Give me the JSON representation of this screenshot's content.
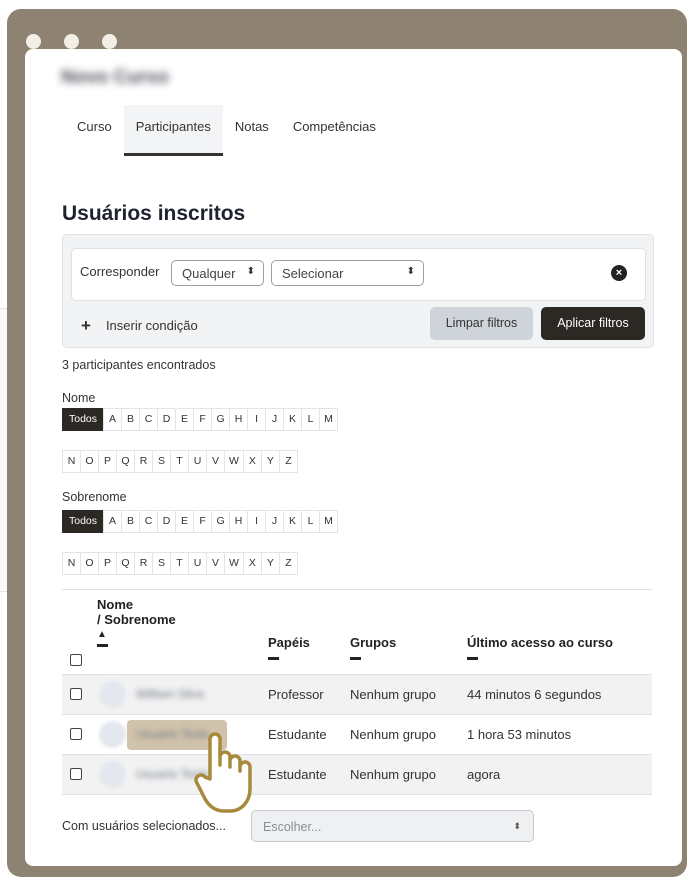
{
  "course": {
    "title": "Novo Curso"
  },
  "tabs": [
    {
      "label": "Curso"
    },
    {
      "label": "Participantes"
    },
    {
      "label": "Notas"
    },
    {
      "label": "Competências"
    }
  ],
  "heading": "Usuários inscritos",
  "filters": {
    "match_label": "Corresponder",
    "match_value": "Qualquer",
    "select_value": "Selecionar",
    "add_condition": "Inserir condição",
    "clear_button": "Limpar filtros",
    "apply_button": "Aplicar filtros"
  },
  "count_text": "3 participantes encontrados",
  "first_name": {
    "label": "Nome",
    "all": "Todos",
    "row1": [
      "A",
      "B",
      "C",
      "D",
      "E",
      "F",
      "G",
      "H",
      "I",
      "J",
      "K",
      "L",
      "M"
    ],
    "row2": [
      "N",
      "O",
      "P",
      "Q",
      "R",
      "S",
      "T",
      "U",
      "V",
      "W",
      "X",
      "Y",
      "Z"
    ]
  },
  "last_name": {
    "label": "Sobrenome",
    "all": "Todos",
    "row1": [
      "A",
      "B",
      "C",
      "D",
      "E",
      "F",
      "G",
      "H",
      "I",
      "J",
      "K",
      "L",
      "M"
    ],
    "row2": [
      "N",
      "O",
      "P",
      "Q",
      "R",
      "S",
      "T",
      "U",
      "V",
      "W",
      "X",
      "Y",
      "Z"
    ]
  },
  "table": {
    "headers": {
      "name_line1": "Nome",
      "name_line2": "/ Sobrenome",
      "roles": "Papéis",
      "groups": "Grupos",
      "last_access": "Último acesso ao curso"
    },
    "rows": [
      {
        "name": "William Silva",
        "initials": "WS",
        "role": "Professor",
        "group": "Nenhum grupo",
        "access": "44 minutos 6 segundos"
      },
      {
        "name": "Usuario Teste",
        "initials": "UT",
        "role": "Estudante",
        "group": "Nenhum grupo",
        "access": "1 hora 53 minutos"
      },
      {
        "name": "Usuario Teste",
        "initials": "UT",
        "role": "Estudante",
        "group": "Nenhum grupo",
        "access": "agora"
      }
    ]
  },
  "bulk": {
    "label": "Com usuários selecionados...",
    "placeholder": "Escolher..."
  },
  "colors": {
    "frame": "#8e8372",
    "dark_button": "#2c2823",
    "hand_cursor": "#a88a3c"
  },
  "icons": [
    "close-circle-icon",
    "plus-icon",
    "sort-up-icon",
    "hand-pointer-icon"
  ]
}
